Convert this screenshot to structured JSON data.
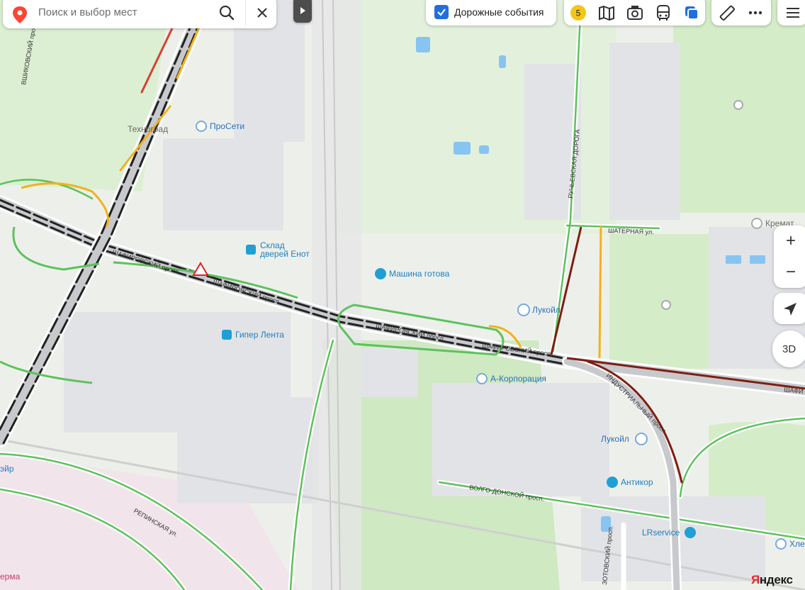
{
  "search": {
    "placeholder": "Поиск и выбор мест"
  },
  "traffic_toggle": {
    "label": "Дорожные события",
    "checked": true
  },
  "layer_buttons": {
    "events_count": "5"
  },
  "zoom": {
    "plus": "+",
    "minus": "−"
  },
  "view_3d": {
    "label": "3D"
  },
  "logo": {
    "text": "Яндекс"
  },
  "colors": {
    "traffic_free": "#3fbf3f",
    "traffic_slow": "#f2b11c",
    "traffic_jam": "#7f1d12",
    "poi": "#1f7fc0",
    "accent": "#1f6fe0"
  },
  "pois": [
    {
      "name": "ПроСети"
    },
    {
      "name": "Техноград"
    },
    {
      "name": "Склад дверей Енот",
      "line1": "Склад",
      "line2": "дверей Енот"
    },
    {
      "name": "Машина готова"
    },
    {
      "name": "Гипер Лента"
    },
    {
      "name": "Лукойл"
    },
    {
      "name": "А-Корпорация"
    },
    {
      "name": "Лукойл"
    },
    {
      "name": "Антикор"
    },
    {
      "name": "LRservice"
    },
    {
      "name": "Хлеб и с"
    },
    {
      "name": "Кремат"
    },
    {
      "name": "эйр"
    },
    {
      "name": "ерма"
    }
  ],
  "streets": [
    {
      "name": "ШАФИРОВСКИЙ просп."
    },
    {
      "name": "ШАФИРОВСКИЙ просп."
    },
    {
      "name": "ШАФИРОВСКИЙ просп."
    },
    {
      "name": "ШАФИРОВСКИЙ просп."
    },
    {
      "name": "ШАФИ"
    },
    {
      "name": "ИНДУСТРИАЛЬНЫЙ просп."
    },
    {
      "name": "РУЧЬЕВСКАЯ ДОРОГА"
    },
    {
      "name": "ШАТЕРНАЯ ул."
    },
    {
      "name": "ВОЛГО-ДОНСКОЙ просп."
    },
    {
      "name": "РЕПИНСКАЯ ул."
    },
    {
      "name": "ЗОТОВСКИЙ просп."
    },
    {
      "name": "ВШИКОВСКИЙ просп."
    }
  ]
}
